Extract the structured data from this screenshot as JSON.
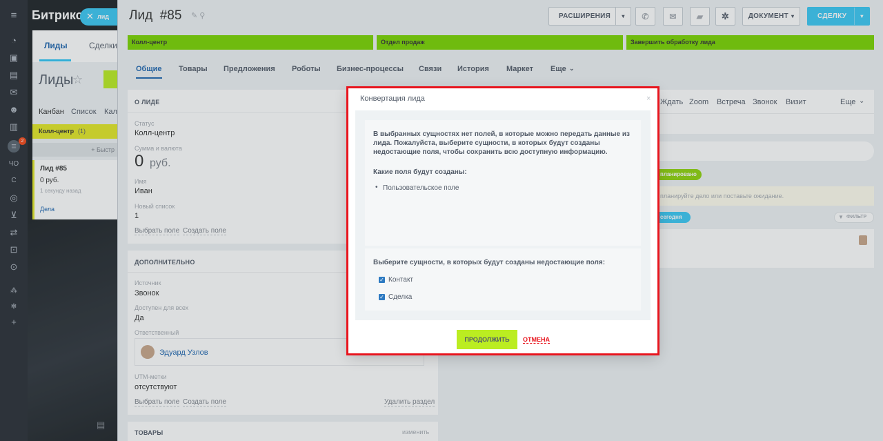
{
  "app": {
    "brand": "Битрикс",
    "tag_label": "лид"
  },
  "left_nav": {
    "counter": "2",
    "items": [
      "ЧО",
      "С"
    ]
  },
  "background": {
    "tabs": [
      "Лиды",
      "Сделки"
    ],
    "page_title": "Лиды",
    "views": [
      "Канбан",
      "Список",
      "Кал"
    ],
    "column": {
      "title": "Колл-центр",
      "count": "(1)"
    },
    "quick_add": "+ Быстр",
    "card": {
      "title": "Лид #85",
      "amount": "0 руб.",
      "time": "1 секунду назад",
      "link": "Дела"
    }
  },
  "header": {
    "title": "Лид  #85",
    "buttons": {
      "extensions": "РАСШИРЕНИЯ",
      "document": "ДОКУМЕНТ",
      "deal": "СДЕЛКУ"
    }
  },
  "stages": [
    "Колл-центр",
    "Отдел продаж",
    "Завершить обработку лида"
  ],
  "tabs": [
    "Общие",
    "Товары",
    "Предложения",
    "Роботы",
    "Бизнес-процессы",
    "Связи",
    "История",
    "Маркет",
    "Еще"
  ],
  "about": {
    "title": "О ЛИДЕ",
    "status_label": "Статус",
    "status_value": "Колл-центр",
    "sum_label": "Сумма и валюта",
    "sum_value": "0",
    "sum_currency": "руб.",
    "name_label": "Имя",
    "name_value": "Иван",
    "list_label": "Новый список",
    "list_value": "1",
    "select_field": "Выбрать поле",
    "create_field": "Создать поле"
  },
  "extra": {
    "title": "ДОПОЛНИТЕЛЬНО",
    "source_label": "Источник",
    "source_value": "Звонок",
    "public_label": "Доступен для всех",
    "public_value": "Да",
    "resp_label": "Ответственный",
    "resp_value": "Эдуард Узлов",
    "utm_label": "UTM-метки",
    "utm_value": "отсутствуют",
    "select_field": "Выбрать поле",
    "create_field": "Создать поле",
    "delete_section": "Удалить раздел"
  },
  "goods": {
    "title": "ТОВАРЫ",
    "edit": "изменить"
  },
  "activity": {
    "tabs": [
      "Ждать",
      "Zoom",
      "Встреча",
      "Звонок",
      "Визит",
      "Еще"
    ],
    "planned": "планировано",
    "hint": "планируйте дело или поставьте ожидание.",
    "today": "сегодня",
    "filter": "ФИЛЬТР"
  },
  "dialog": {
    "title": "Конвертация лида",
    "message": "В выбранных сущностях нет полей, в которые можно передать данные из лида. Пожалуйста, выберите сущности, в которых будут созданы недостающие поля, чтобы сохранить всю доступную информацию.",
    "fields_heading": "Какие поля будут созданы:",
    "fields": [
      "Пользовательское поле"
    ],
    "entities_heading": "Выберите сущности, в которых будут созданы недостающие поля:",
    "entities": [
      {
        "label": "Контакт",
        "checked": true
      },
      {
        "label": "Сделка",
        "checked": true
      }
    ],
    "continue": "ПРОДОЛЖИТЬ",
    "cancel": "ОТМЕНА"
  },
  "colors": {
    "accent_green": "#7bd500",
    "primary_blue": "#3bc8f5",
    "danger_red": "#e8141d",
    "button_green": "#bbed21"
  }
}
